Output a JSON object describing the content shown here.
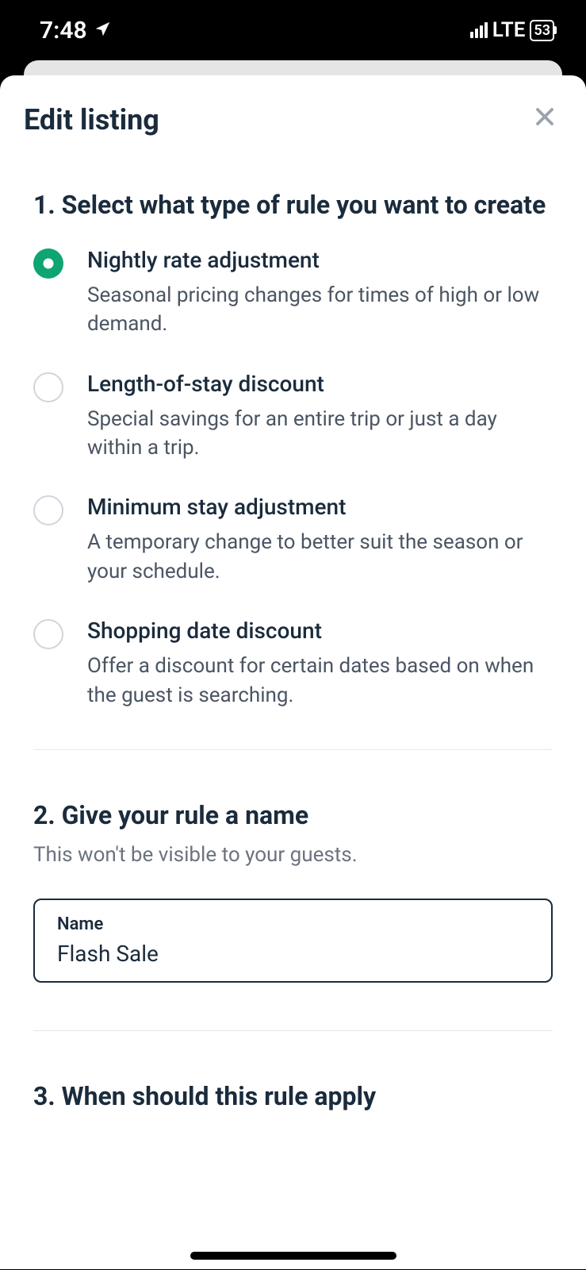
{
  "statusBar": {
    "time": "7:48",
    "network": "LTE",
    "battery": "53"
  },
  "sheet": {
    "title": "Edit listing"
  },
  "section1": {
    "title": "1. Select what type of rule you want to create",
    "options": [
      {
        "label": "Nightly rate adjustment",
        "description": "Seasonal pricing changes for times of high or low demand.",
        "selected": true
      },
      {
        "label": "Length-of-stay discount",
        "description": "Special savings for an entire trip or just a day within a trip.",
        "selected": false
      },
      {
        "label": "Minimum stay adjustment",
        "description": "A temporary change to better suit the season or your schedule.",
        "selected": false
      },
      {
        "label": "Shopping date discount",
        "description": "Offer a discount for certain dates based on when the guest is searching.",
        "selected": false
      }
    ]
  },
  "section2": {
    "title": "2. Give your rule a name",
    "subtitle": "This won't be visible to your guests.",
    "inputLabel": "Name",
    "inputValue": "Flash Sale"
  },
  "section3": {
    "title": "3. When should this rule apply"
  }
}
